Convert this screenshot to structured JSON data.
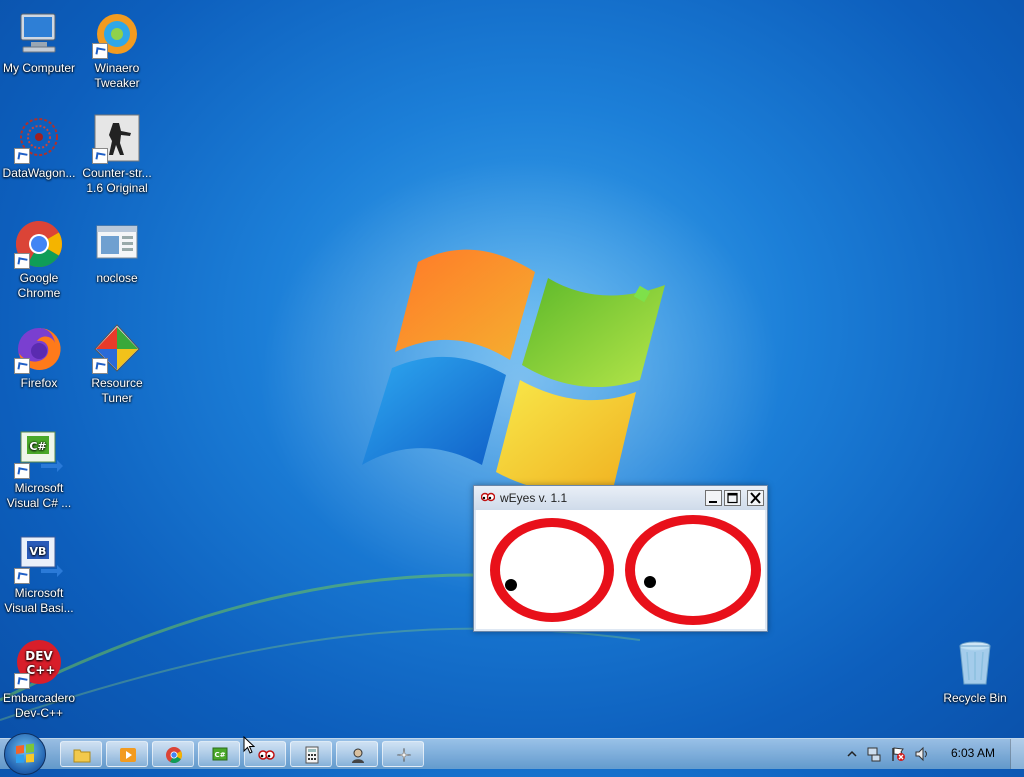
{
  "desktop": {
    "icons": [
      {
        "label": "My Computer",
        "icon": "computer-icon"
      },
      {
        "label": "Winaero Tweaker",
        "icon": "winaero-icon"
      },
      {
        "label": "DataWagon...",
        "icon": "datawagon-icon"
      },
      {
        "label": "Counter-str... 1.6 Original",
        "icon": "counter-strike-icon"
      },
      {
        "label": "Google Chrome",
        "icon": "chrome-icon"
      },
      {
        "label": "noclose",
        "icon": "noclose-icon"
      },
      {
        "label": "Firefox",
        "icon": "firefox-icon"
      },
      {
        "label": "Resource Tuner",
        "icon": "resource-tuner-icon"
      },
      {
        "label": "Microsoft Visual C# ...",
        "icon": "visual-csharp-icon"
      },
      {
        "label": "Microsoft Visual Basi...",
        "icon": "visual-basic-icon"
      },
      {
        "label": "Embarcadero Dev-C++",
        "icon": "devcpp-icon"
      },
      {
        "label": "Recycle Bin",
        "icon": "recycle-bin-icon"
      }
    ]
  },
  "weyes": {
    "title": "wEyes v. 1.1",
    "eye_color": "#e8101a",
    "pupil_color": "#000000"
  },
  "taskbar": {
    "pinned": [
      {
        "name": "explorer",
        "icon": "folder-icon"
      },
      {
        "name": "media-player",
        "icon": "media-player-icon"
      },
      {
        "name": "chrome",
        "icon": "chrome-icon"
      },
      {
        "name": "visual-csharp",
        "icon": "visual-csharp-icon"
      },
      {
        "name": "weyes",
        "icon": "weyes-icon"
      },
      {
        "name": "calculator",
        "icon": "calculator-icon"
      },
      {
        "name": "user-app",
        "icon": "person-icon"
      },
      {
        "name": "tool-app",
        "icon": "sparkle-icon"
      }
    ],
    "clock": "6:03 AM"
  },
  "colors": {
    "desktop_blue": "#1c7fd8",
    "window_frame": "#dfe8f3"
  }
}
